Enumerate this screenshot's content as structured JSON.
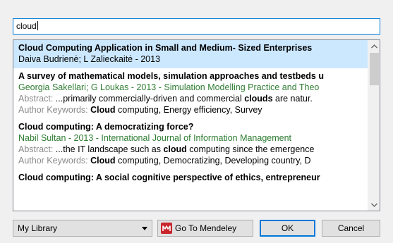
{
  "search": {
    "value": "cloud"
  },
  "results": [
    {
      "title": "Cloud Computing Application in Small and Medium- Sized Enterprises",
      "meta": "Daiva Budrienė; L Zalieckaitė - 2013",
      "selected": true
    },
    {
      "title": "A survey of mathematical models, simulation approaches and testbeds u",
      "meta": "Georgia Sakellari; G Loukas - 2013 - Simulation Modelling Practice and Theo",
      "abstract_label": "Abstract:",
      "abstract_pre": " ...primarily commercially-driven and commercial ",
      "abstract_bold": "clouds",
      "abstract_post": " are natur.",
      "keywords_label": "Author Keywords:",
      "keywords_bold": "Cloud",
      "keywords_post": " computing, Energy efficiency, Survey"
    },
    {
      "title": "Cloud computing: A democratizing force?",
      "meta": "Nabil Sultan - 2013 - International Journal of Information Management",
      "abstract_label": "Abstract:",
      "abstract_pre": " ...the IT landscape such as ",
      "abstract_bold": "cloud",
      "abstract_post": " computing since the emergence",
      "keywords_label": "Author Keywords:",
      "keywords_bold": "Cloud",
      "keywords_post": " computing, Democratizing, Developing country, D"
    },
    {
      "title": "Cloud computing: A social cognitive perspective of ethics, entrepreneur"
    }
  ],
  "bottom": {
    "library": "My Library",
    "mendeley_label": "Go To Mendeley",
    "ok_label": "OK",
    "cancel_label": "Cancel"
  },
  "icons": {
    "mendeley": "mendeley-logo-icon",
    "scroll_up": "chevron-up-icon",
    "scroll_down": "chevron-down-icon",
    "dropdown": "chevron-down-icon"
  },
  "colors": {
    "selection": "#cce8ff",
    "meta_green": "#2e7d32",
    "label_gray": "#8a8a8a",
    "focus_blue": "#0078d7",
    "mendeley_red": "#c9252c"
  }
}
